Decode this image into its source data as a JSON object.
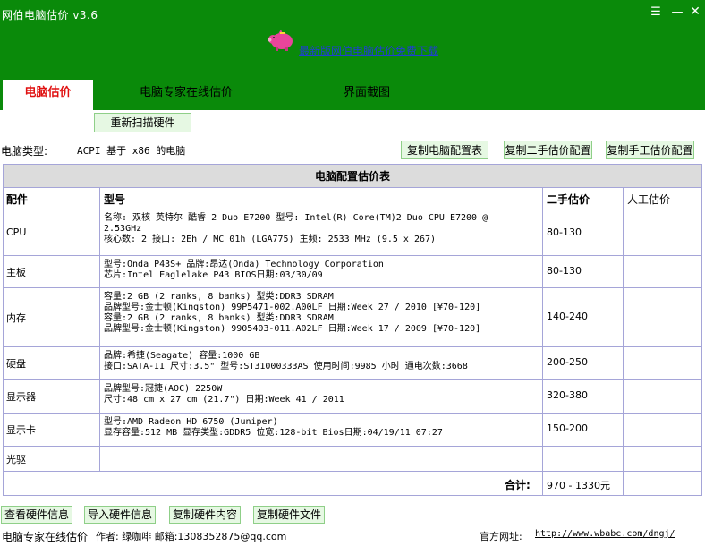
{
  "window": {
    "title": "网伯电脑估价 v3.6",
    "menu_glyph": "☰",
    "min_glyph": "—",
    "close_glyph": "✕"
  },
  "download_link": "最新版网伯电脑估价免费下载",
  "tabs": [
    {
      "label": "电脑估价"
    },
    {
      "label": "电脑专家在线估价"
    },
    {
      "label": "界面截图"
    }
  ],
  "buttons": {
    "rescan": "重新扫描硬件",
    "copy_config": "复制电脑配置表",
    "copy_second_hand": "复制二手估价配置",
    "copy_manual": "复制手工估价配置",
    "view_info": "查看硬件信息",
    "import_info": "导入硬件信息",
    "copy_content": "复制硬件内容",
    "copy_file": "复制硬件文件"
  },
  "pc_type": {
    "label": "电脑类型:",
    "value": "ACPI 基于 x86 的电脑"
  },
  "table": {
    "caption": "电脑配置估价表",
    "headers": [
      "配件",
      "型号",
      "二手估价",
      "人工估价"
    ],
    "rows": [
      {
        "part": "CPU",
        "model": "名称: 双核 英特尔 酷睿 2 Duo E7200 型号: Intel(R) Core(TM)2 Duo CPU E7200 @\n2.53GHz\n核心数: 2 接口: 2Eh / MC 01h (LGA775) 主频: 2533 MHz (9.5 x 267)",
        "price": "80-130",
        "manual": ""
      },
      {
        "part": "主板",
        "model": "型号:Onda P43S+ 品牌:昂达(Onda) Technology Corporation\n芯片:Intel Eaglelake P43 BIOS日期:03/30/09",
        "price": "80-130",
        "manual": ""
      },
      {
        "part": "内存",
        "model": "容量:2 GB (2 ranks, 8 banks) 型类:DDR3 SDRAM\n品牌型号:金士顿(Kingston) 99P5471-002.A00LF 日期:Week 27 / 2010 [¥70-120]\n容量:2 GB (2 ranks, 8 banks) 型类:DDR3 SDRAM\n品牌型号:金士顿(Kingston) 9905403-011.A02LF 日期:Week 17 / 2009 [¥70-120]",
        "price": "140-240",
        "manual": ""
      },
      {
        "part": "硬盘",
        "model": "品牌:希捷(Seagate) 容量:1000 GB\n接口:SATA-II 尺寸:3.5\" 型号:ST31000333AS 使用时间:9985 小时 通电次数:3668",
        "price": "200-250",
        "manual": ""
      },
      {
        "part": "显示器",
        "model": "品牌型号:冠捷(AOC) 2250W\n尺寸:48 cm x 27 cm (21.7\") 日期:Week 41 / 2011",
        "price": "320-380",
        "manual": ""
      },
      {
        "part": "显示卡",
        "model": "型号:AMD Radeon HD 6750 (Juniper)\n显存容量:512 MB 显存类型:GDDR5 位宽:128-bit Bios日期:04/19/11 07:27",
        "price": "150-200",
        "manual": ""
      },
      {
        "part": "光驱",
        "model": "",
        "price": "",
        "manual": ""
      }
    ],
    "total_label": "合计:",
    "total_value": "970 - 1330元"
  },
  "footer": {
    "link": "电脑专家在线估价",
    "author": "作者: 绿咖啡 邮箱:1308352875@qq.com",
    "site_label": "官方网址:",
    "site_url": "http://www.wbabc.com/dngj/"
  },
  "colors": {
    "header_green": "#0a8a0a",
    "active_tab_text": "#e01010",
    "link_blue": "#1f3fd0",
    "button_bg": "#e6f8e3",
    "grid_line": "#a5a5d8"
  }
}
